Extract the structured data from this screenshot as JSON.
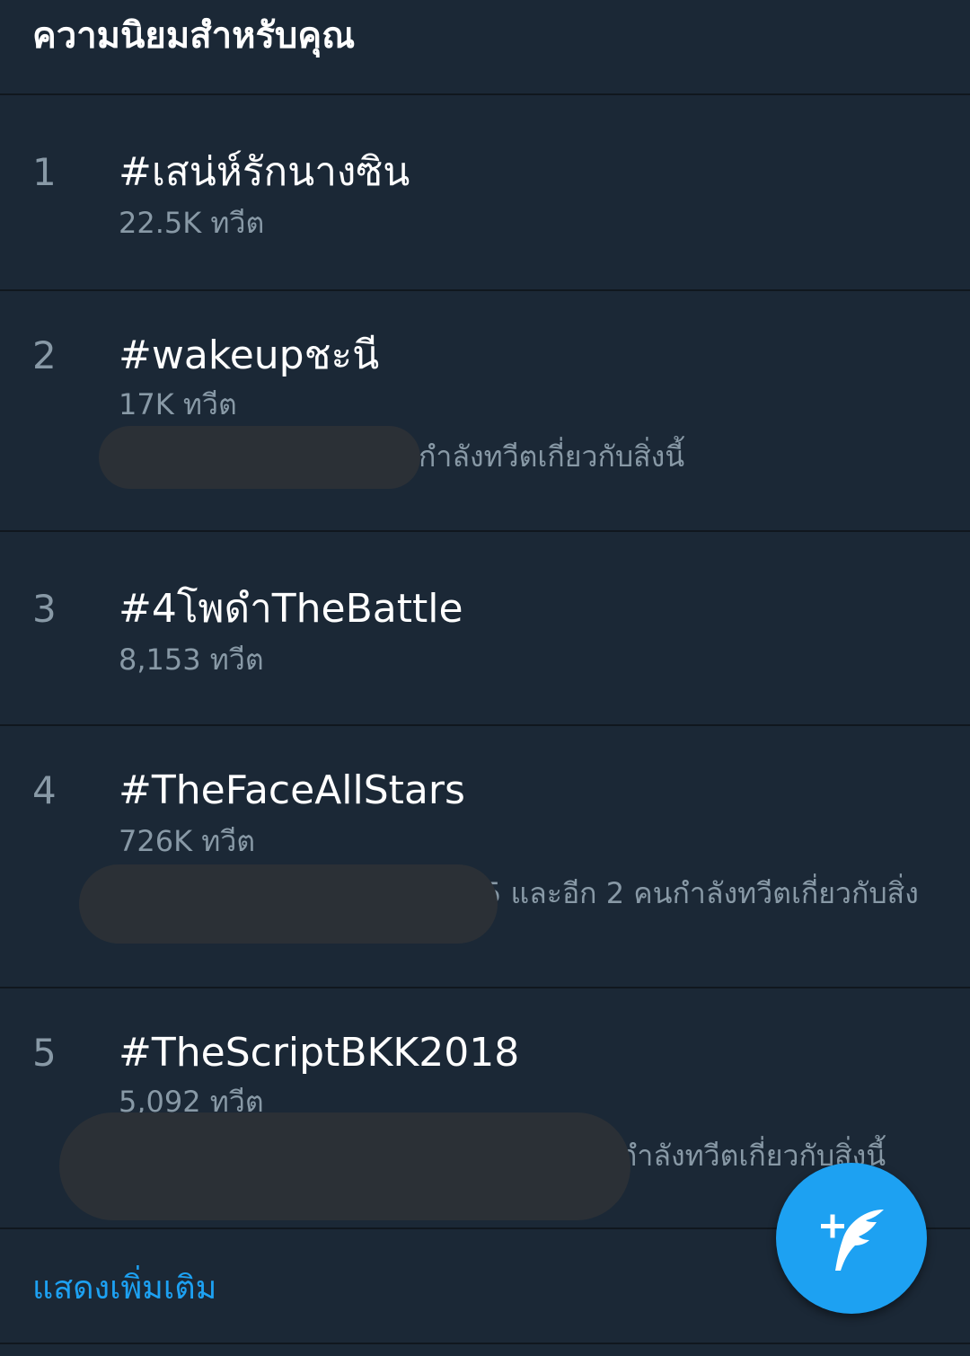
{
  "header": {
    "title": "ความนิยมสำหรับคุณ"
  },
  "trends": [
    {
      "rank": "1",
      "tag": "#เสน่ห์รักนางซิน",
      "count": "22.5K ทวีต"
    },
    {
      "rank": "2",
      "tag": "#wakeupชะนี",
      "count": "17K ทวีต",
      "context": "กำลังทวีตเกี่ยวกับสิ่งนี้"
    },
    {
      "rank": "3",
      "tag": "#4โพดำTheBattle",
      "count": "8,153 ทวีต"
    },
    {
      "rank": "4",
      "tag": "#TheFaceAllStars",
      "count": "726K ทวีต",
      "context": "5 และอีก 2 คนกำลังทวีตเกี่ยวกับสิ่ง"
    },
    {
      "rank": "5",
      "tag": "#TheScriptBKK2018",
      "count": "5,092 ทวีต",
      "context": "กำลังทวีตเกี่ยวกับสิ่งนี้"
    }
  ],
  "footer": {
    "show_more": "แสดงเพิ่มเติม"
  },
  "compose_button": {
    "icon": "compose-feather-plus-icon"
  },
  "colors": {
    "background": "#1b2836",
    "divider": "#10171e",
    "secondary_text": "#8899a6",
    "accent": "#1da1f2"
  }
}
